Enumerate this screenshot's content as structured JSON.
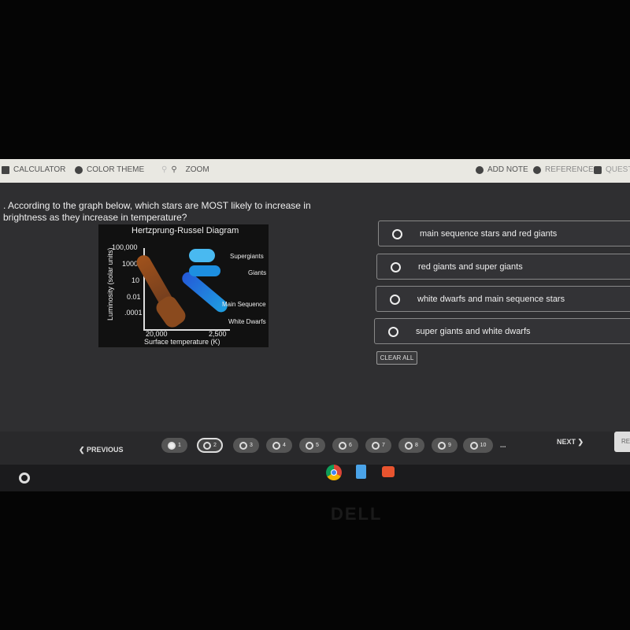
{
  "toolbar": {
    "calculator": "CALCULATOR",
    "color_theme": "COLOR THEME",
    "zoom": "ZOOM",
    "add_note": "ADD NOTE",
    "reference": "REFERENCE",
    "question": "QUESTIO"
  },
  "question": {
    "text": ". According to the graph below, which stars are MOST likely to increase in brightness as they increase in temperature?"
  },
  "diagram": {
    "title": "Hertzprung-Russel Diagram",
    "ylabel": "Luminosity (solar units)",
    "yticks": [
      "100,000",
      "1000",
      "10",
      "0.01",
      ".0001"
    ],
    "xticks": [
      "20,000",
      "2,500"
    ],
    "xlabel": "Surface temperature (K)",
    "labels": [
      "Supergiants",
      "Giants",
      "Main Sequence",
      "White Dwarfs"
    ]
  },
  "options": [
    {
      "label": "main sequence stars and red giants"
    },
    {
      "label": "red giants and super giants"
    },
    {
      "label": "white dwarfs and main sequence stars"
    },
    {
      "label": "super giants and white dwarfs"
    }
  ],
  "clear_all": "CLEAR ALL",
  "nav": {
    "previous": "PREVIOUS",
    "next": "NEXT",
    "review": "RE",
    "more": "...",
    "pages": [
      "1",
      "2",
      "3",
      "4",
      "5",
      "6",
      "7",
      "8",
      "9",
      "10"
    ],
    "answered": [
      "1"
    ],
    "current": "2"
  },
  "bezel_logo": "DELL"
}
